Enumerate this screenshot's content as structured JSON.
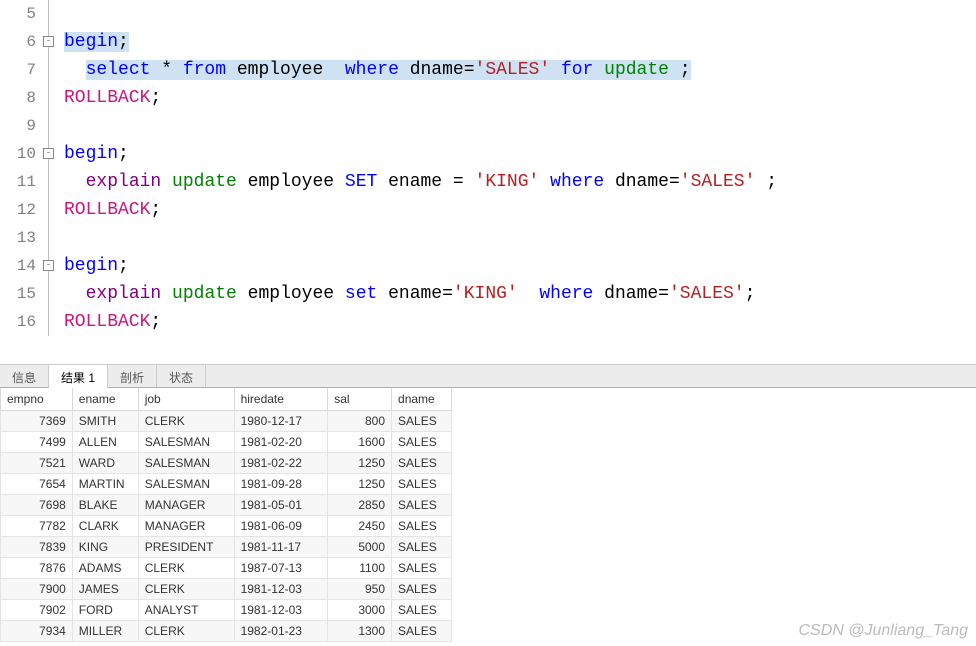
{
  "gutter": [
    "5",
    "6",
    "7",
    "8",
    "9",
    "10",
    "11",
    "12",
    "13",
    "14",
    "15",
    "16"
  ],
  "code": {
    "l6_begin": "begin",
    "l7_select": "select",
    "l7_star": " * ",
    "l7_from": "from",
    "l7_tbl": " employee  ",
    "l7_where": "where",
    "l7_col": " dname=",
    "l7_str": "'SALES'",
    "l7_for": " for ",
    "l7_update": "update",
    "l7_end": " ;",
    "l8_rollback": "ROLLBACK",
    "l10_begin": "begin",
    "l11_explain": "explain",
    "l11_update": "update",
    "l11_tbl": " employee ",
    "l11_set": "SET",
    "l11_col1": " ename = ",
    "l11_str1": "'KING'",
    "l11_where": "where",
    "l11_col2": " dname=",
    "l11_str2": "'SALES'",
    "l11_end": " ;",
    "l12_rollback": "ROLLBACK",
    "l14_begin": "begin",
    "l15_explain": "explain",
    "l15_update": "update",
    "l15_tbl": " employee ",
    "l15_set": "set",
    "l15_col1": " ename=",
    "l15_str1": "'KING'",
    "l15_where": "where",
    "l15_col2": " dname=",
    "l15_str2": "'SALES'",
    "l16_rollback": "ROLLBACK"
  },
  "tabs": {
    "info": "信息",
    "result": "结果 1",
    "profile": "剖析",
    "status": "状态"
  },
  "headers": {
    "empno": "empno",
    "ename": "ename",
    "job": "job",
    "hiredate": "hiredate",
    "sal": "sal",
    "dname": "dname"
  },
  "rows": [
    {
      "empno": "7369",
      "ename": "SMITH",
      "job": "CLERK",
      "hiredate": "1980-12-17",
      "sal": "800",
      "dname": "SALES"
    },
    {
      "empno": "7499",
      "ename": "ALLEN",
      "job": "SALESMAN",
      "hiredate": "1981-02-20",
      "sal": "1600",
      "dname": "SALES"
    },
    {
      "empno": "7521",
      "ename": "WARD",
      "job": "SALESMAN",
      "hiredate": "1981-02-22",
      "sal": "1250",
      "dname": "SALES"
    },
    {
      "empno": "7654",
      "ename": "MARTIN",
      "job": "SALESMAN",
      "hiredate": "1981-09-28",
      "sal": "1250",
      "dname": "SALES"
    },
    {
      "empno": "7698",
      "ename": "BLAKE",
      "job": "MANAGER",
      "hiredate": "1981-05-01",
      "sal": "2850",
      "dname": "SALES"
    },
    {
      "empno": "7782",
      "ename": "CLARK",
      "job": "MANAGER",
      "hiredate": "1981-06-09",
      "sal": "2450",
      "dname": "SALES"
    },
    {
      "empno": "7839",
      "ename": "KING",
      "job": "PRESIDENT",
      "hiredate": "1981-11-17",
      "sal": "5000",
      "dname": "SALES"
    },
    {
      "empno": "7876",
      "ename": "ADAMS",
      "job": "CLERK",
      "hiredate": "1987-07-13",
      "sal": "1100",
      "dname": "SALES"
    },
    {
      "empno": "7900",
      "ename": "JAMES",
      "job": "CLERK",
      "hiredate": "1981-12-03",
      "sal": "950",
      "dname": "SALES"
    },
    {
      "empno": "7902",
      "ename": "FORD",
      "job": "ANALYST",
      "hiredate": "1981-12-03",
      "sal": "3000",
      "dname": "SALES"
    },
    {
      "empno": "7934",
      "ename": "MILLER",
      "job": "CLERK",
      "hiredate": "1982-01-23",
      "sal": "1300",
      "dname": "SALES"
    }
  ],
  "watermark": "CSDN @Junliang_Tang"
}
